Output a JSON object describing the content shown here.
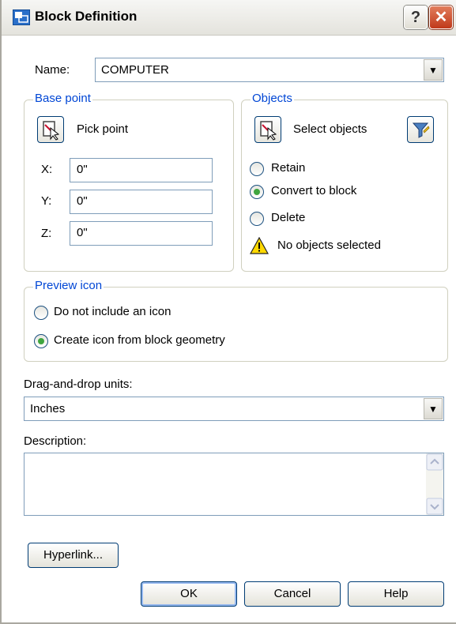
{
  "window": {
    "title": "Block Definition",
    "help_glyph": "?",
    "close_glyph": "✕"
  },
  "name_field": {
    "label": "Name:",
    "value": "COMPUTER",
    "arrow": "▼"
  },
  "base_point": {
    "legend": "Base point",
    "pick_label": "Pick point",
    "x_label": "X:",
    "x_value": "0\"",
    "y_label": "Y:",
    "y_value": "0\"",
    "z_label": "Z:",
    "z_value": "0\""
  },
  "objects": {
    "legend": "Objects",
    "select_label": "Select objects",
    "retain": "Retain",
    "convert": "Convert to block",
    "delete": "Delete",
    "selected_option": "convert",
    "warning": "No objects selected"
  },
  "preview": {
    "legend": "Preview icon",
    "option_none": "Do not include an icon",
    "option_geometry": "Create icon from block geometry",
    "selected_option": "geometry"
  },
  "units": {
    "label": "Drag-and-drop units:",
    "value": "Inches",
    "arrow": "▼"
  },
  "description": {
    "label": "Description:",
    "value": ""
  },
  "buttons": {
    "hyperlink": "Hyperlink...",
    "ok": "OK",
    "cancel": "Cancel",
    "help": "Help"
  },
  "colors": {
    "group_legend": "#0046d5",
    "field_border": "#7f9db9",
    "button_border": "#003c74"
  }
}
